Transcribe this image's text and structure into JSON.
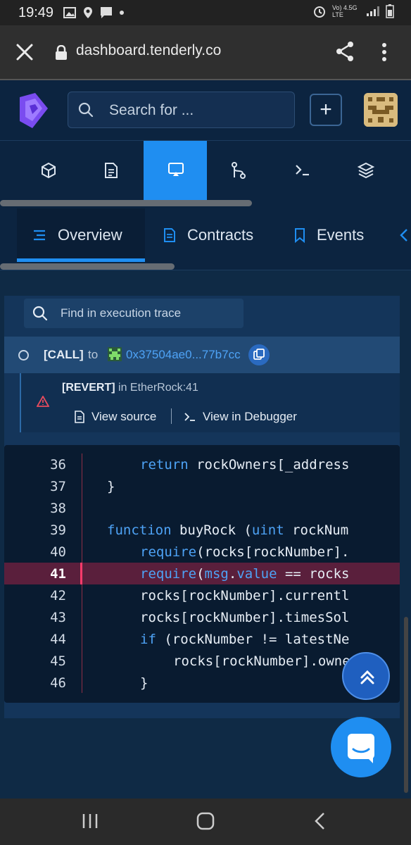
{
  "status": {
    "time": "19:49",
    "network": "Vo) 4.5G LTE"
  },
  "browser": {
    "url": "dashboard.tenderly.co"
  },
  "header": {
    "search_placeholder": "Search for ...",
    "add_label": "+"
  },
  "iconnav": {
    "items": [
      {
        "icon": "cube-icon"
      },
      {
        "icon": "document-icon"
      },
      {
        "icon": "monitor-icon",
        "active": true
      },
      {
        "icon": "git-icon"
      },
      {
        "icon": "terminal-icon"
      },
      {
        "icon": "layers-icon"
      }
    ]
  },
  "tabs": [
    {
      "label": "Overview",
      "icon": "list-icon",
      "active": true
    },
    {
      "label": "Contracts",
      "icon": "document-icon"
    },
    {
      "label": "Events",
      "icon": "bookmark-icon"
    }
  ],
  "trace": {
    "search_placeholder": "Find in execution trace",
    "call": {
      "type": "[CALL]",
      "to_label": "to",
      "address": "0x37504ae0...77b7cc"
    },
    "revert": {
      "label": "[REVERT]",
      "location": "in EtherRock:41",
      "view_source": "View source",
      "view_debugger": "View in Debugger"
    }
  },
  "code": {
    "highlight_line": 41,
    "lines": [
      {
        "n": "36",
        "indent": 2,
        "parts": [
          [
            "kw",
            "return"
          ],
          [
            "t",
            " rockOwners[_address"
          ]
        ]
      },
      {
        "n": "37",
        "indent": 1,
        "parts": [
          [
            "t",
            "}"
          ]
        ]
      },
      {
        "n": "38",
        "indent": 0,
        "parts": []
      },
      {
        "n": "39",
        "indent": 1,
        "parts": [
          [
            "kw",
            "function"
          ],
          [
            "t",
            " buyRock ("
          ],
          [
            "kw",
            "uint"
          ],
          [
            "t",
            " rockNum"
          ]
        ]
      },
      {
        "n": "40",
        "indent": 2,
        "parts": [
          [
            "kw",
            "require"
          ],
          [
            "t",
            "(rocks[rockNumber]."
          ]
        ]
      },
      {
        "n": "41",
        "indent": 2,
        "parts": [
          [
            "kw",
            "require"
          ],
          [
            "t",
            "("
          ],
          [
            "kw",
            "msg"
          ],
          [
            "t",
            "."
          ],
          [
            "kw",
            "value"
          ],
          [
            "t",
            " == rocks"
          ]
        ]
      },
      {
        "n": "42",
        "indent": 2,
        "parts": [
          [
            "t",
            "rocks[rockNumber].currentl"
          ]
        ]
      },
      {
        "n": "43",
        "indent": 2,
        "parts": [
          [
            "t",
            "rocks[rockNumber].timesSol"
          ]
        ]
      },
      {
        "n": "44",
        "indent": 2,
        "parts": [
          [
            "kw",
            "if"
          ],
          [
            "t",
            " (rockNumber != latestNe"
          ]
        ]
      },
      {
        "n": "45",
        "indent": 3,
        "parts": [
          [
            "t",
            "rocks[rockNumber].owne"
          ]
        ]
      },
      {
        "n": "46",
        "indent": 2,
        "parts": [
          [
            "t",
            "}"
          ]
        ]
      }
    ]
  },
  "colors": {
    "accent": "#1f8ef1",
    "bg": "#0f2a45",
    "highlight": "#5a1f3c"
  }
}
